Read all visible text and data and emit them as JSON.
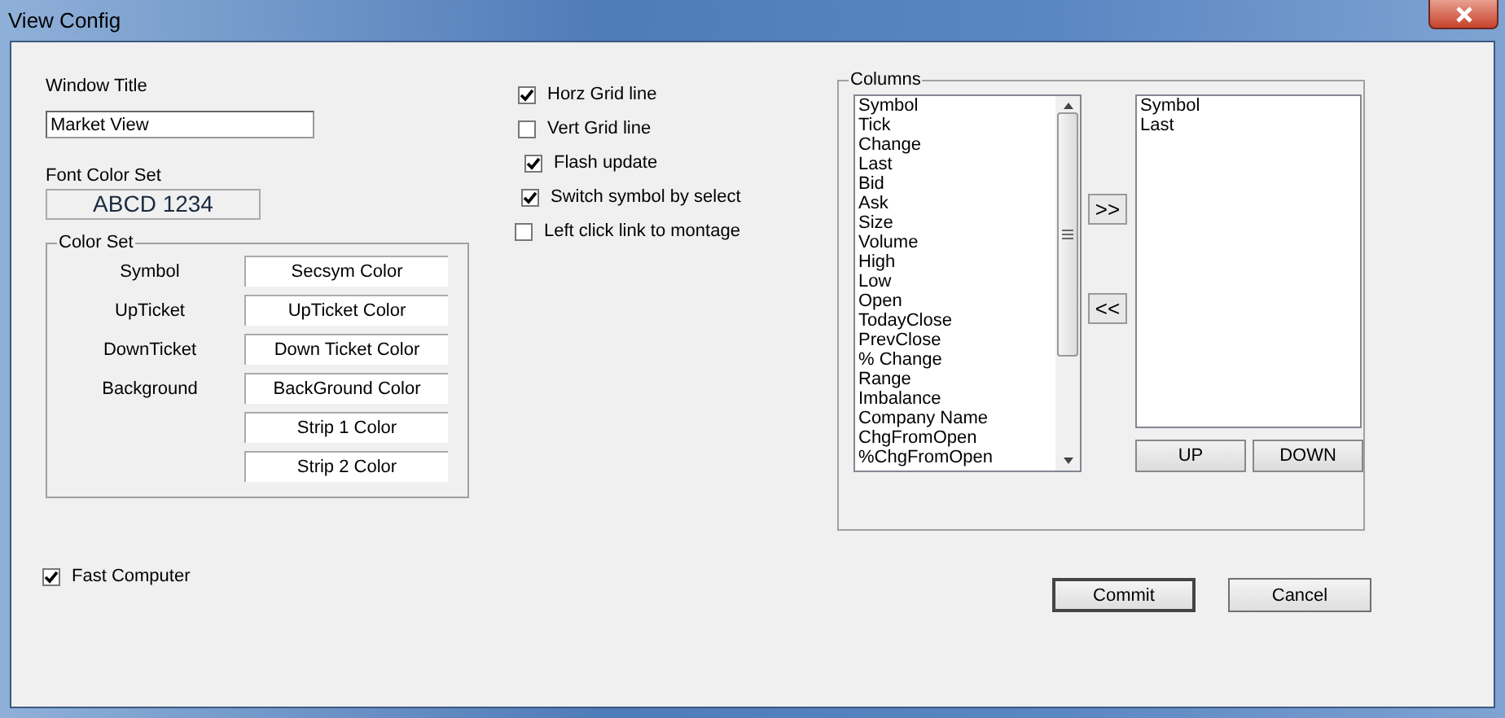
{
  "window": {
    "title": "View Config"
  },
  "window_title": {
    "label": "Window Title",
    "value": "Market View"
  },
  "font_color_set": {
    "label": "Font  Color Set",
    "sample": "ABCD 1234"
  },
  "color_set": {
    "title": "Color Set",
    "rows": [
      {
        "label": "Symbol",
        "button": "Secsym Color"
      },
      {
        "label": "UpTicket",
        "button": "UpTicket Color"
      },
      {
        "label": "DownTicket",
        "button": "Down Ticket Color"
      },
      {
        "label": "Background",
        "button": "BackGround Color"
      },
      {
        "label": "",
        "button": "Strip 1 Color"
      },
      {
        "label": "",
        "button": "Strip 2 Color"
      }
    ]
  },
  "options": [
    {
      "label": "Horz Grid line",
      "checked": true
    },
    {
      "label": "Vert Grid line",
      "checked": false
    },
    {
      "label": "Flash update",
      "checked": true
    },
    {
      "label": "Switch symbol by select",
      "checked": true
    },
    {
      "label": "Left click link to montage",
      "checked": false
    }
  ],
  "columns": {
    "title": "Columns",
    "available": [
      "Symbol",
      "Tick",
      "Change",
      "Last",
      "Bid",
      "Ask",
      "Size",
      "Volume",
      "High",
      "Low",
      "Open",
      "TodayClose",
      "PrevClose",
      "% Change",
      "Range",
      "Imbalance",
      "Company Name",
      "ChgFromOpen",
      "%ChgFromOpen"
    ],
    "add_button": ">>",
    "remove_button": "<<",
    "selected": [
      "Symbol",
      "Last"
    ],
    "up_button": "UP",
    "down_button": "DOWN"
  },
  "fast_computer": {
    "label": "Fast Computer",
    "checked": true
  },
  "buttons": [
    {
      "label": "Commit",
      "default": true
    },
    {
      "label": "Cancel",
      "default": false
    }
  ]
}
